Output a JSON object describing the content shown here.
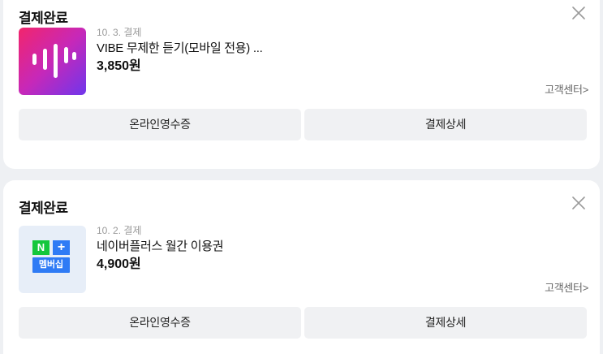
{
  "orders": [
    {
      "status": "결제완료",
      "date": "10. 3. 결제",
      "product": "VIBE 무제한 듣기(모바일 전용) ...",
      "price": "3,850원",
      "support_link": "고객센터>",
      "receipt_button": "온라인영수증",
      "detail_button": "결제상세",
      "thumbnail_icon": "vibe-logo-icon"
    },
    {
      "status": "결제완료",
      "date": "10. 2. 결제",
      "product": "네이버플러스 월간 이용권",
      "price": "4,900원",
      "support_link": "고객센터>",
      "receipt_button": "온라인영수증",
      "detail_button": "결제상세",
      "thumbnail_icon": "naver-plus-membership-icon",
      "thumbnail_text": {
        "n": "N",
        "plus": "+",
        "label": "멤버십"
      }
    }
  ],
  "colors": {
    "background": "#eef0f3",
    "card": "#ffffff",
    "button_bg": "#f0f1f3",
    "vibe_gradient": [
      "#f2256c",
      "#c728b8",
      "#6f36ec"
    ],
    "naver_green": "#14c73c",
    "naver_blue": "#2f7bf5"
  }
}
